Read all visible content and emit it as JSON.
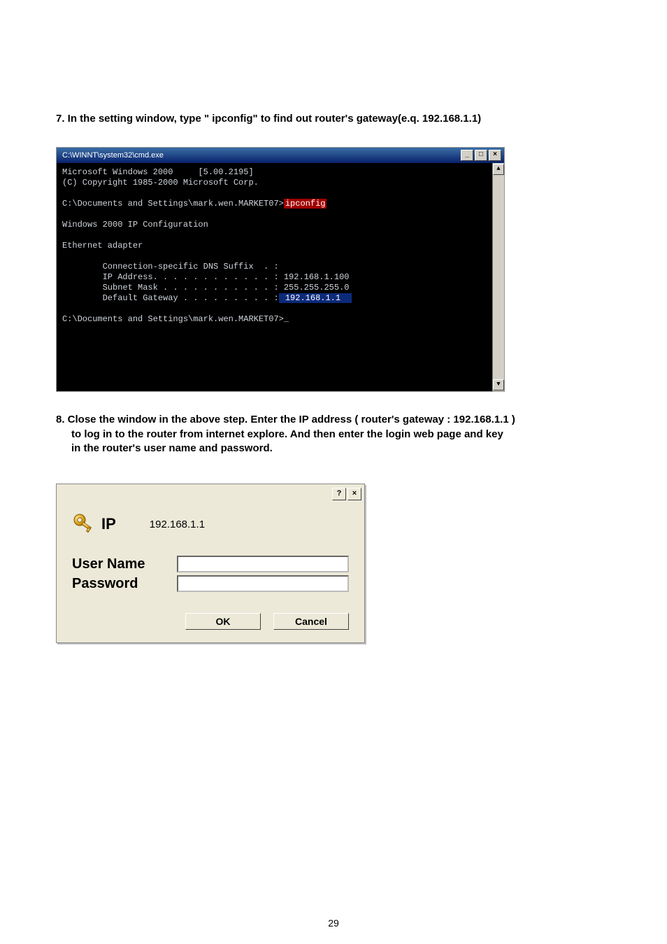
{
  "step7": {
    "text": "7. In the setting window, type \" ipconfig\" to  find out router's gateway(e.q. 192.168.1.1)"
  },
  "cmd": {
    "title": "C:\\WINNT\\system32\\cmd.exe",
    "buttons": {
      "min": "_",
      "max": "□",
      "close": "×"
    },
    "scroll": {
      "up": "▲",
      "down": "▼"
    },
    "line1_a": "Microsoft Windows 2000",
    "line1_b": "[5.00.2195]",
    "line2": "(C) Copyright 1985-2000 Microsoft Corp.",
    "line3_prompt": "C:\\Documents and Settings\\mark.wen.MARKET07>",
    "line3_cmd": "ipconfig",
    "line5": "Windows 2000 IP Configuration",
    "line6": "Ethernet adapter",
    "line7": "        Connection-specific DNS Suffix  . :",
    "line8": "        IP Address. . . . . . . . . . . . : 192.168.1.100",
    "line9": "        Subnet Mask . . . . . . . . . . . : 255.255.255.0",
    "line10_a": "        Default Gateway . . . . . . . . . :",
    "line10_b": " 192.168.1.1  ",
    "line11": "C:\\Documents and Settings\\mark.wen.MARKET07>",
    "cursor": "_"
  },
  "step8": {
    "l1": "8. Close the window  in the above step. Enter the IP address ( router's gateway : 192.168.1.1 )",
    "l2": "to log in to the router from internet explore. And then enter the login web page and key",
    "l3": "in the router's user name and password."
  },
  "dialog": {
    "help": "?",
    "close": "×",
    "ip_label": "IP",
    "ip_value": "192.168.1.1",
    "username_label": "User Name",
    "password_label": "Password",
    "ok": "OK",
    "cancel": "Cancel"
  },
  "page_number": "29"
}
